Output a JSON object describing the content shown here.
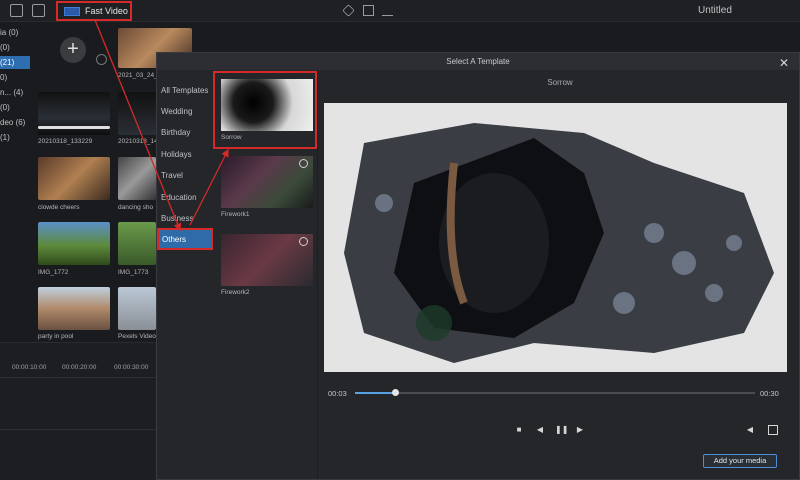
{
  "topbar": {
    "tab_fast_video": "Fast Video",
    "title": "Untitled"
  },
  "sidebar": {
    "items": [
      "ia (0)",
      "(0)",
      "(21)",
      "0)",
      "n... (4)",
      "(0)",
      "deo (6)",
      "(1)"
    ]
  },
  "media": {
    "items": [
      {
        "label": "2021_03_24_1"
      },
      {
        "label": "20210318_133229"
      },
      {
        "label": "20210318_14"
      },
      {
        "label": "clowde cheers"
      },
      {
        "label": "dancing sho"
      },
      {
        "label": "IMG_1772"
      },
      {
        "label": "IMG_1773"
      },
      {
        "label": "party in pool"
      },
      {
        "label": "Pexels Video"
      }
    ]
  },
  "timeline": {
    "times": [
      "00:00:10:00",
      "00:00:20:00",
      "00:00:30:00"
    ]
  },
  "dialog": {
    "title": "Select A Template",
    "categories": [
      "All Templates",
      "Wedding",
      "Birthday",
      "Holidays",
      "Travel",
      "Education",
      "Business",
      "Others"
    ],
    "templates": [
      {
        "label": "Sorrow"
      },
      {
        "label": "Firework1"
      },
      {
        "label": "Firework2"
      }
    ],
    "preview_title": "Sorrow",
    "time_current": "00:03",
    "time_total": "00:30",
    "progress_fraction": 0.1,
    "add_media_label": "Add your media"
  },
  "colors": {
    "accent": "#2f6aa9",
    "highlight_red": "#d42a2a",
    "progress": "#5aa2e6"
  }
}
